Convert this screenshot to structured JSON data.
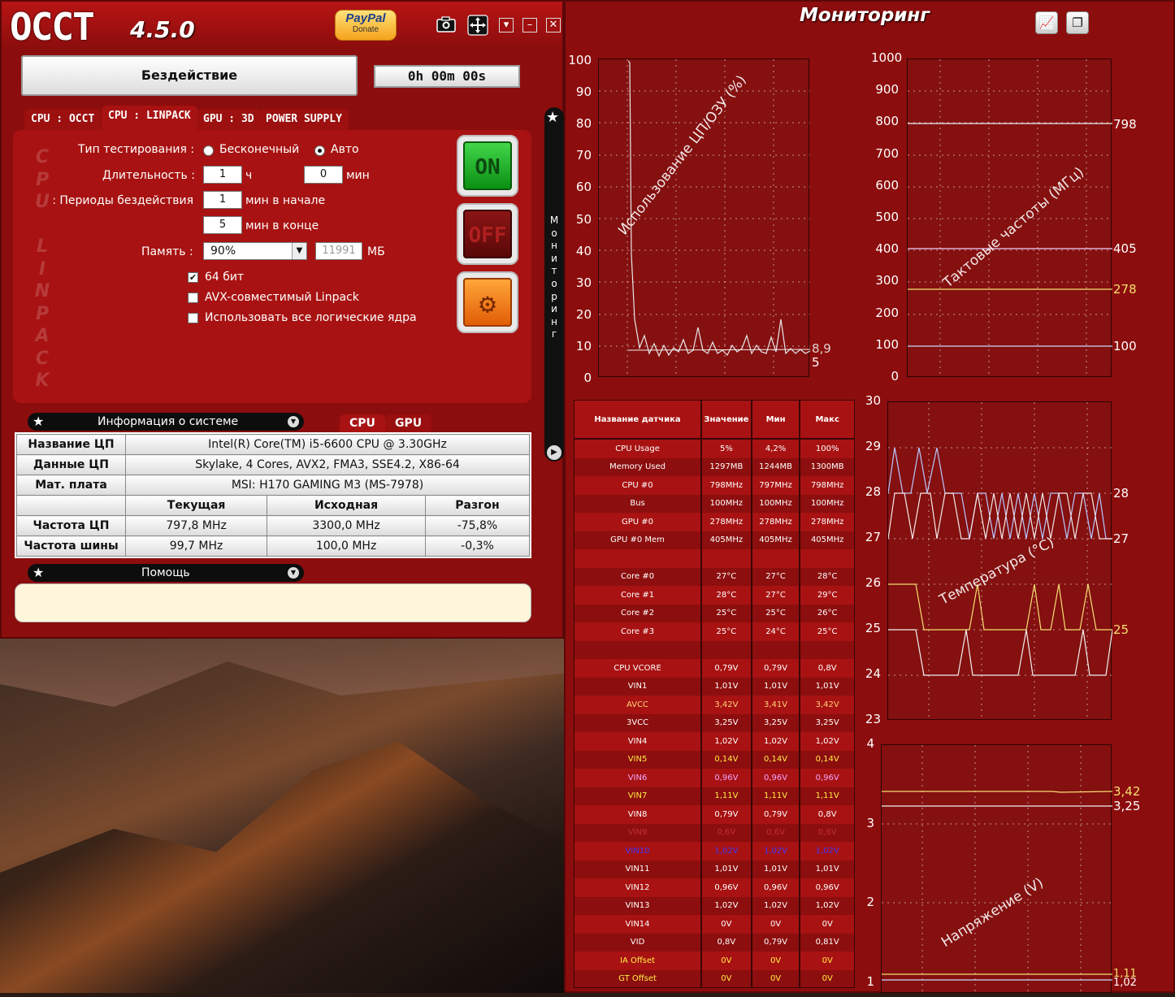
{
  "app": {
    "logo": "OCCT",
    "version": "4.5.0",
    "paypal": "PayPal",
    "donate": "Donate"
  },
  "status": "Бездействие",
  "timer": "0h 00m 00s",
  "tabs": [
    "CPU : OCCT",
    "CPU : LINPACK",
    "GPU : 3D",
    "POWER SUPPLY"
  ],
  "vertical_letters": [
    "C",
    "P",
    "U",
    "",
    "L",
    "I",
    "N",
    "P",
    "A",
    "C",
    "K"
  ],
  "form": {
    "test_type_label": "Тип тестирования :",
    "opt_infinite": "Бесконечный",
    "opt_auto": "Авто",
    "duration_label": "Длительность :",
    "duration_h": "1",
    "unit_h": "ч",
    "duration_min": "0",
    "unit_min": "мин",
    "idle_label": "Периоды бездействия :",
    "idle_start": "1",
    "idle_start_unit": "мин в начале",
    "idle_end": "5",
    "idle_end_unit": "мин в конце",
    "memory_label": "Память :",
    "memory_value": "90%",
    "memory_mb": "11991",
    "memory_unit": "МБ",
    "cb_64": "64 бит",
    "cb_avx": "AVX-совместимый Linpack",
    "cb_cores": "Использовать все логические ядра"
  },
  "buttons": {
    "on": "ON",
    "off": "OFF"
  },
  "side": "Мониторинг",
  "sysinfo_bar": "Информация о системе",
  "sysinfo_tabs": [
    "CPU",
    "GPU"
  ],
  "sysinfo": {
    "rows": [
      {
        "h": "Название ЦП",
        "v": "Intel(R) Core(TM) i5-6600 CPU @ 3.30GHz"
      },
      {
        "h": "Данные ЦП",
        "v": "Skylake, 4 Cores, AVX2, FMA3, SSE4.2, X86-64"
      },
      {
        "h": "Мат. плата",
        "v": "MSI: H170 GAMING M3 (MS-7978)"
      }
    ],
    "cols": [
      "Текущая",
      "Исходная",
      "Разгон"
    ],
    "freq": [
      {
        "h": "Частота ЦП",
        "a": "797,8 MHz",
        "b": "3300,0 MHz",
        "c": "-75,8%"
      },
      {
        "h": "Частота шины",
        "a": "99,7 MHz",
        "b": "100,0 MHz",
        "c": "-0,3%"
      }
    ]
  },
  "help_bar": "Помощь",
  "monitor": {
    "title": "Мониторинг",
    "cpu_chart": {
      "label": "Использование ЦП/ОЗУ (%)",
      "ticks": [
        "100",
        "90",
        "80",
        "70",
        "60",
        "50",
        "40",
        "30",
        "20",
        "10",
        "0"
      ],
      "last": [
        "8,9",
        "5"
      ]
    },
    "clock_chart": {
      "label": "Тактовые частоты (МГц)",
      "ticks": [
        "1000",
        "900",
        "800",
        "700",
        "600",
        "500",
        "400",
        "300",
        "200",
        "100",
        "0"
      ],
      "levels": [
        "798",
        "405",
        "278",
        "100"
      ]
    },
    "temp_chart": {
      "label": "Температура (°C)",
      "ticks": [
        "30",
        "29",
        "28",
        "27",
        "26",
        "25",
        "24",
        "23"
      ],
      "levels": [
        "28",
        "27",
        "25"
      ]
    },
    "volt_chart": {
      "label": "Напряжение (V)",
      "ticks": [
        "4",
        "3",
        "2",
        "1"
      ],
      "levels": [
        "3,42",
        "3,25",
        "1,11",
        "1,02"
      ]
    }
  },
  "sensors": {
    "headers": [
      "Название датчика",
      "Значение",
      "Мин",
      "Макс"
    ],
    "rows": [
      {
        "n": "CPU Usage",
        "v": "5%",
        "mn": "4,2%",
        "mx": "100%",
        "c": "#ffffff"
      },
      {
        "n": "Memory Used",
        "v": "1297MB",
        "mn": "1244MB",
        "mx": "1300MB",
        "c": "#ffffff"
      },
      {
        "n": "CPU #0",
        "v": "798MHz",
        "mn": "797MHz",
        "mx": "798MHz",
        "c": "#ffffff"
      },
      {
        "n": "Bus",
        "v": "100MHz",
        "mn": "100MHz",
        "mx": "100MHz",
        "c": "#ffffff"
      },
      {
        "n": "GPU #0",
        "v": "278MHz",
        "mn": "278MHz",
        "mx": "278MHz",
        "c": "#ffffff"
      },
      {
        "n": "GPU #0 Mem",
        "v": "405MHz",
        "mn": "405MHz",
        "mx": "405MHz",
        "c": "#ffffff"
      },
      {
        "n": "",
        "v": "",
        "mn": "",
        "mx": "",
        "c": "#ffffff"
      },
      {
        "n": "Core #0",
        "v": "27°C",
        "mn": "27°C",
        "mx": "28°C",
        "c": "#ffffff"
      },
      {
        "n": "Core #1",
        "v": "28°C",
        "mn": "27°C",
        "mx": "29°C",
        "c": "#ffffff"
      },
      {
        "n": "Core #2",
        "v": "25°C",
        "mn": "25°C",
        "mx": "26°C",
        "c": "#ffffff"
      },
      {
        "n": "Core #3",
        "v": "25°C",
        "mn": "24°C",
        "mx": "25°C",
        "c": "#ffffff"
      },
      {
        "n": "",
        "v": "",
        "mn": "",
        "mx": "",
        "c": "#ffffff"
      },
      {
        "n": "CPU VCORE",
        "v": "0,79V",
        "mn": "0,79V",
        "mx": "0,8V",
        "c": "#ffffff"
      },
      {
        "n": "VIN1",
        "v": "1,01V",
        "mn": "1,01V",
        "mx": "1,01V",
        "c": "#ffffff"
      },
      {
        "n": "AVCC",
        "v": "3,42V",
        "mn": "3,41V",
        "mx": "3,42V",
        "c": "#ffd27a"
      },
      {
        "n": "3VCC",
        "v": "3,25V",
        "mn": "3,25V",
        "mx": "3,25V",
        "c": "#ffffff"
      },
      {
        "n": "VIN4",
        "v": "1,02V",
        "mn": "1,02V",
        "mx": "1,02V",
        "c": "#ffffff"
      },
      {
        "n": "VIN5",
        "v": "0,14V",
        "mn": "0,14V",
        "mx": "0,14V",
        "c": "#ffee44"
      },
      {
        "n": "VIN6",
        "v": "0,96V",
        "mn": "0,96V",
        "mx": "0,96V",
        "c": "#f2a6ff"
      },
      {
        "n": "VIN7",
        "v": "1,11V",
        "mn": "1,11V",
        "mx": "1,11V",
        "c": "#ffee44"
      },
      {
        "n": "VIN8",
        "v": "0,79V",
        "mn": "0,79V",
        "mx": "0,8V",
        "c": "#ffffff"
      },
      {
        "n": "VIN9",
        "v": "0,6V",
        "mn": "0,6V",
        "mx": "0,6V",
        "c": "#c43030"
      },
      {
        "n": "VIN10",
        "v": "1,02V",
        "mn": "1,02V",
        "mx": "1,02V",
        "c": "#3a3aff"
      },
      {
        "n": "VIN11",
        "v": "1,01V",
        "mn": "1,01V",
        "mx": "1,01V",
        "c": "#ffffff"
      },
      {
        "n": "VIN12",
        "v": "0,96V",
        "mn": "0,96V",
        "mx": "0,96V",
        "c": "#ffffff"
      },
      {
        "n": "VIN13",
        "v": "1,02V",
        "mn": "1,02V",
        "mx": "1,02V",
        "c": "#ffffff"
      },
      {
        "n": "VIN14",
        "v": "0V",
        "mn": "0V",
        "mx": "0V",
        "c": "#ffffff"
      },
      {
        "n": "VID",
        "v": "0,8V",
        "mn": "0,79V",
        "mx": "0,81V",
        "c": "#ffffff"
      },
      {
        "n": "IA Offset",
        "v": "0V",
        "mn": "0V",
        "mx": "0V",
        "c": "#ffee44"
      },
      {
        "n": "GT Offset",
        "v": "0V",
        "mn": "0V",
        "mx": "0V",
        "c": "#ffee44"
      }
    ]
  }
}
